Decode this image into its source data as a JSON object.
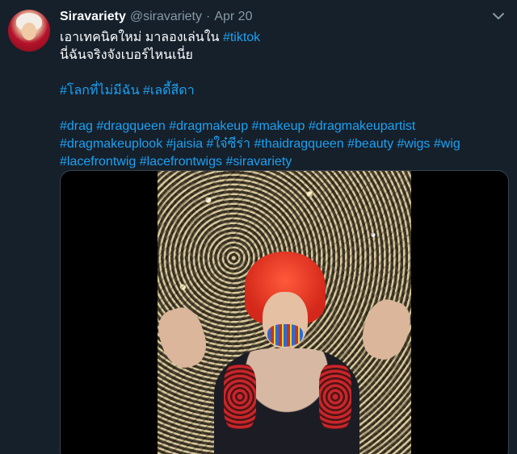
{
  "tweet": {
    "display_name": "Siravariety",
    "handle": "@siravariety",
    "separator": "·",
    "date": "Apr 20",
    "lines": [
      [
        {
          "text": "เอาเทคนิคใหม่ มาลองเล่นใน ",
          "tag": false
        },
        {
          "text": "#tiktok",
          "tag": true
        }
      ],
      [
        {
          "text": "นี่ฉันจริงจังเบอร์ไหนเนี่ย",
          "tag": false
        }
      ],
      [],
      [
        {
          "text": "#โลกที่ไม่มีฉัน",
          "tag": true
        },
        {
          "text": " ",
          "tag": false
        },
        {
          "text": "#เลดี้สีดา",
          "tag": true
        }
      ],
      [],
      [
        {
          "text": "#drag",
          "tag": true
        },
        {
          "text": " ",
          "tag": false
        },
        {
          "text": "#dragqueen",
          "tag": true
        },
        {
          "text": " ",
          "tag": false
        },
        {
          "text": "#dragmakeup",
          "tag": true
        },
        {
          "text": " ",
          "tag": false
        },
        {
          "text": "#makeup",
          "tag": true
        },
        {
          "text": " ",
          "tag": false
        },
        {
          "text": "#dragmakeupartist",
          "tag": true
        }
      ],
      [
        {
          "text": "#dragmakeuplook",
          "tag": true
        },
        {
          "text": " ",
          "tag": false
        },
        {
          "text": "#jaisia",
          "tag": true
        },
        {
          "text": " ",
          "tag": false
        },
        {
          "text": "#ใจ๋ซีร่า",
          "tag": true
        },
        {
          "text": " ",
          "tag": false
        },
        {
          "text": "#thaidragqueen",
          "tag": true
        },
        {
          "text": " ",
          "tag": false
        },
        {
          "text": "#beauty",
          "tag": true
        },
        {
          "text": " ",
          "tag": false
        },
        {
          "text": "#wigs",
          "tag": true
        },
        {
          "text": " ",
          "tag": false
        },
        {
          "text": "#wig",
          "tag": true
        }
      ],
      [
        {
          "text": "#lacefrontwig",
          "tag": true
        },
        {
          "text": " ",
          "tag": false
        },
        {
          "text": "#lacefrontwigs",
          "tag": true
        },
        {
          "text": " ",
          "tag": false
        },
        {
          "text": "#siravariety",
          "tag": true
        }
      ]
    ]
  },
  "colors": {
    "background": "#15202b",
    "text": "#ffffff",
    "secondary": "#8899a6",
    "link": "#1da1f2",
    "border": "#38444d"
  },
  "icons": {
    "more": "chevron-down-icon"
  }
}
